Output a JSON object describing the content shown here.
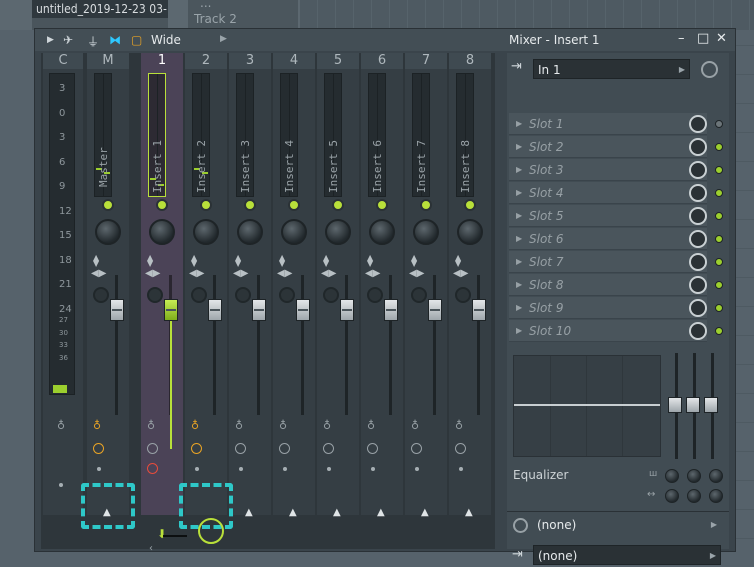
{
  "background": {
    "project_tab": "untitled_2019-12-23 03-...",
    "playlist_track": "Track 2",
    "playlist_dots": "..."
  },
  "mixer": {
    "title": "Mixer - Insert 1",
    "view_mode": "Wide",
    "headers": [
      "C",
      "M",
      "1",
      "2",
      "3",
      "4",
      "5",
      "6",
      "7",
      "8"
    ],
    "strip_names": [
      "Master",
      "Insert 1",
      "Insert 2",
      "Insert 3",
      "Insert 4",
      "Insert 5",
      "Insert 6",
      "Insert 7",
      "Insert 8"
    ],
    "db_scale": [
      "3",
      "0",
      "3",
      "6",
      "9",
      "12",
      "15",
      "18",
      "21",
      "24",
      "27",
      "30",
      "33",
      "36"
    ],
    "selected_insert": 1
  },
  "panel": {
    "input": "In 1",
    "slots": [
      "Slot 1",
      "Slot 2",
      "Slot 3",
      "Slot 4",
      "Slot 5",
      "Slot 6",
      "Slot 7",
      "Slot 8",
      "Slot 9",
      "Slot 10"
    ],
    "equalizer_label": "Equalizer",
    "latency_value": "(none)",
    "output_value": "(none)"
  },
  "colors": {
    "accent_green": "#9ccf2e",
    "highlight_cyan": "#2ec8c8",
    "selected_strip": "#4b4357"
  }
}
